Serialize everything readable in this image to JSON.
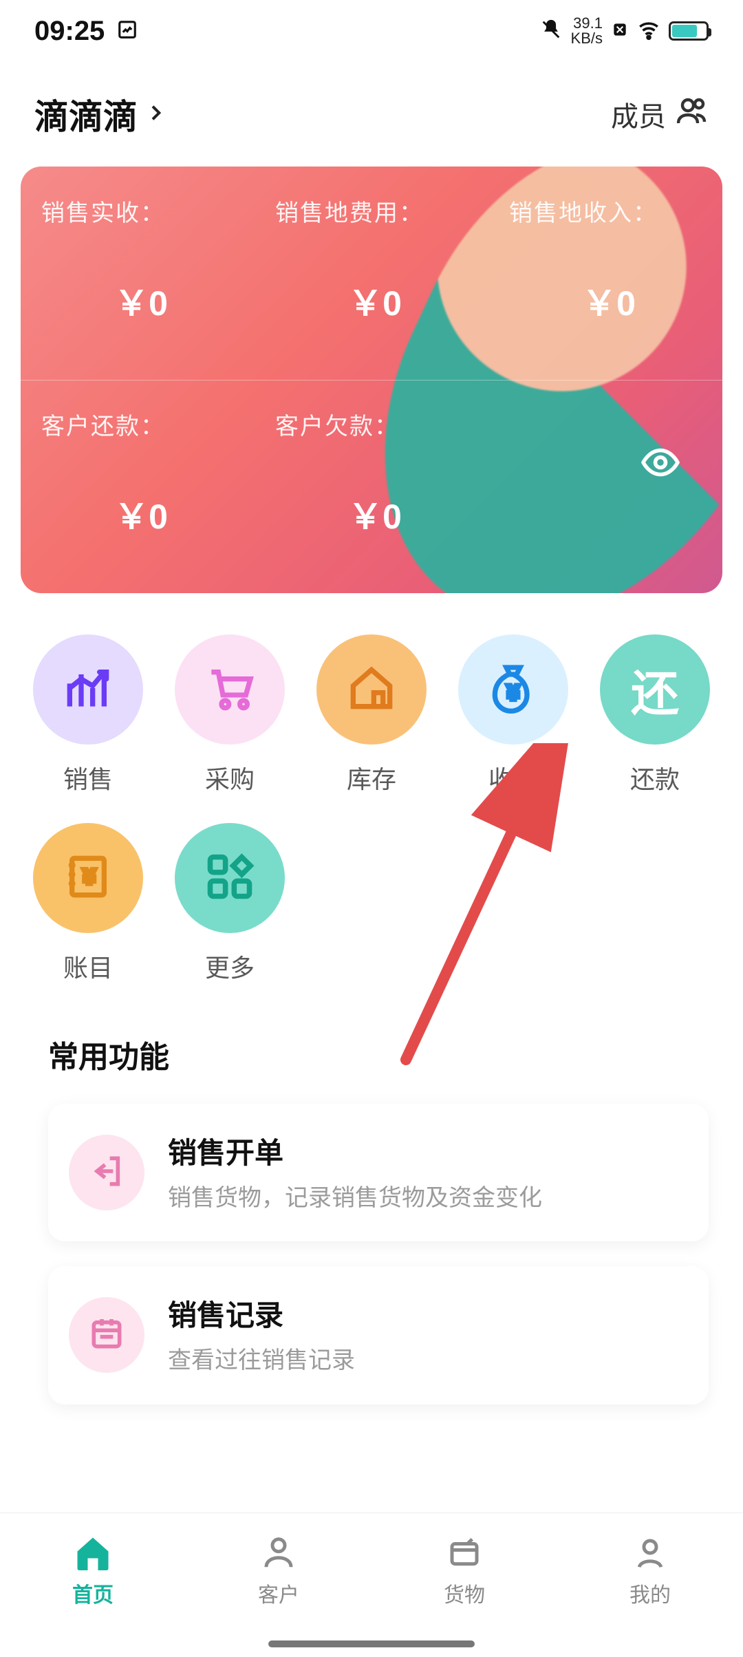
{
  "status": {
    "time": "09:25",
    "net_value": "39.1",
    "net_unit": "KB/s"
  },
  "header": {
    "title": "滴滴滴",
    "members_label": "成员"
  },
  "summary": {
    "row1": [
      {
        "label": "销售实收：",
        "value": "￥0"
      },
      {
        "label": "销售地费用：",
        "value": "￥0"
      },
      {
        "label": "销售地收入：",
        "value": "￥0"
      }
    ],
    "row2": [
      {
        "label": "客户还款：",
        "value": "￥0"
      },
      {
        "label": "客户欠款：",
        "value": "￥0"
      }
    ]
  },
  "menu": [
    {
      "label": "销售",
      "icon": "chart-up-icon",
      "circle": "c-purple",
      "glyph_class": "g-purple"
    },
    {
      "label": "采购",
      "icon": "cart-icon",
      "circle": "c-pink",
      "glyph_class": "g-pink"
    },
    {
      "label": "库存",
      "icon": "house-icon",
      "circle": "c-orange",
      "glyph_class": "g-orange"
    },
    {
      "label": "收支",
      "icon": "moneybag-icon",
      "circle": "c-blue",
      "glyph_class": "g-blue"
    },
    {
      "label": "还款",
      "icon": "repay-glyph",
      "circle": "c-teal",
      "glyph_class": "g-teal",
      "glyph_text": "还"
    },
    {
      "label": "账目",
      "icon": "ledger-icon",
      "circle": "c-yellow",
      "glyph_class": "g-yellow"
    },
    {
      "label": "更多",
      "icon": "grid-icon",
      "circle": "c-mint",
      "glyph_class": "g-mint"
    }
  ],
  "frequent": {
    "section_title": "常用功能",
    "items": [
      {
        "title": "销售开单",
        "desc": "销售货物，记录销售货物及资金变化",
        "icon": "exit-icon"
      },
      {
        "title": "销售记录",
        "desc": "查看过往销售记录",
        "icon": "calendar-icon"
      }
    ]
  },
  "nav": [
    {
      "label": "首页",
      "icon": "home-icon",
      "active": true
    },
    {
      "label": "客户",
      "icon": "person-icon",
      "active": false
    },
    {
      "label": "货物",
      "icon": "box-icon",
      "active": false
    },
    {
      "label": "我的",
      "icon": "profile-icon",
      "active": false
    }
  ],
  "colors": {
    "accent_teal": "#16B39C",
    "card_gradient_from": "#f58b8a",
    "card_gradient_to": "#d05990"
  }
}
